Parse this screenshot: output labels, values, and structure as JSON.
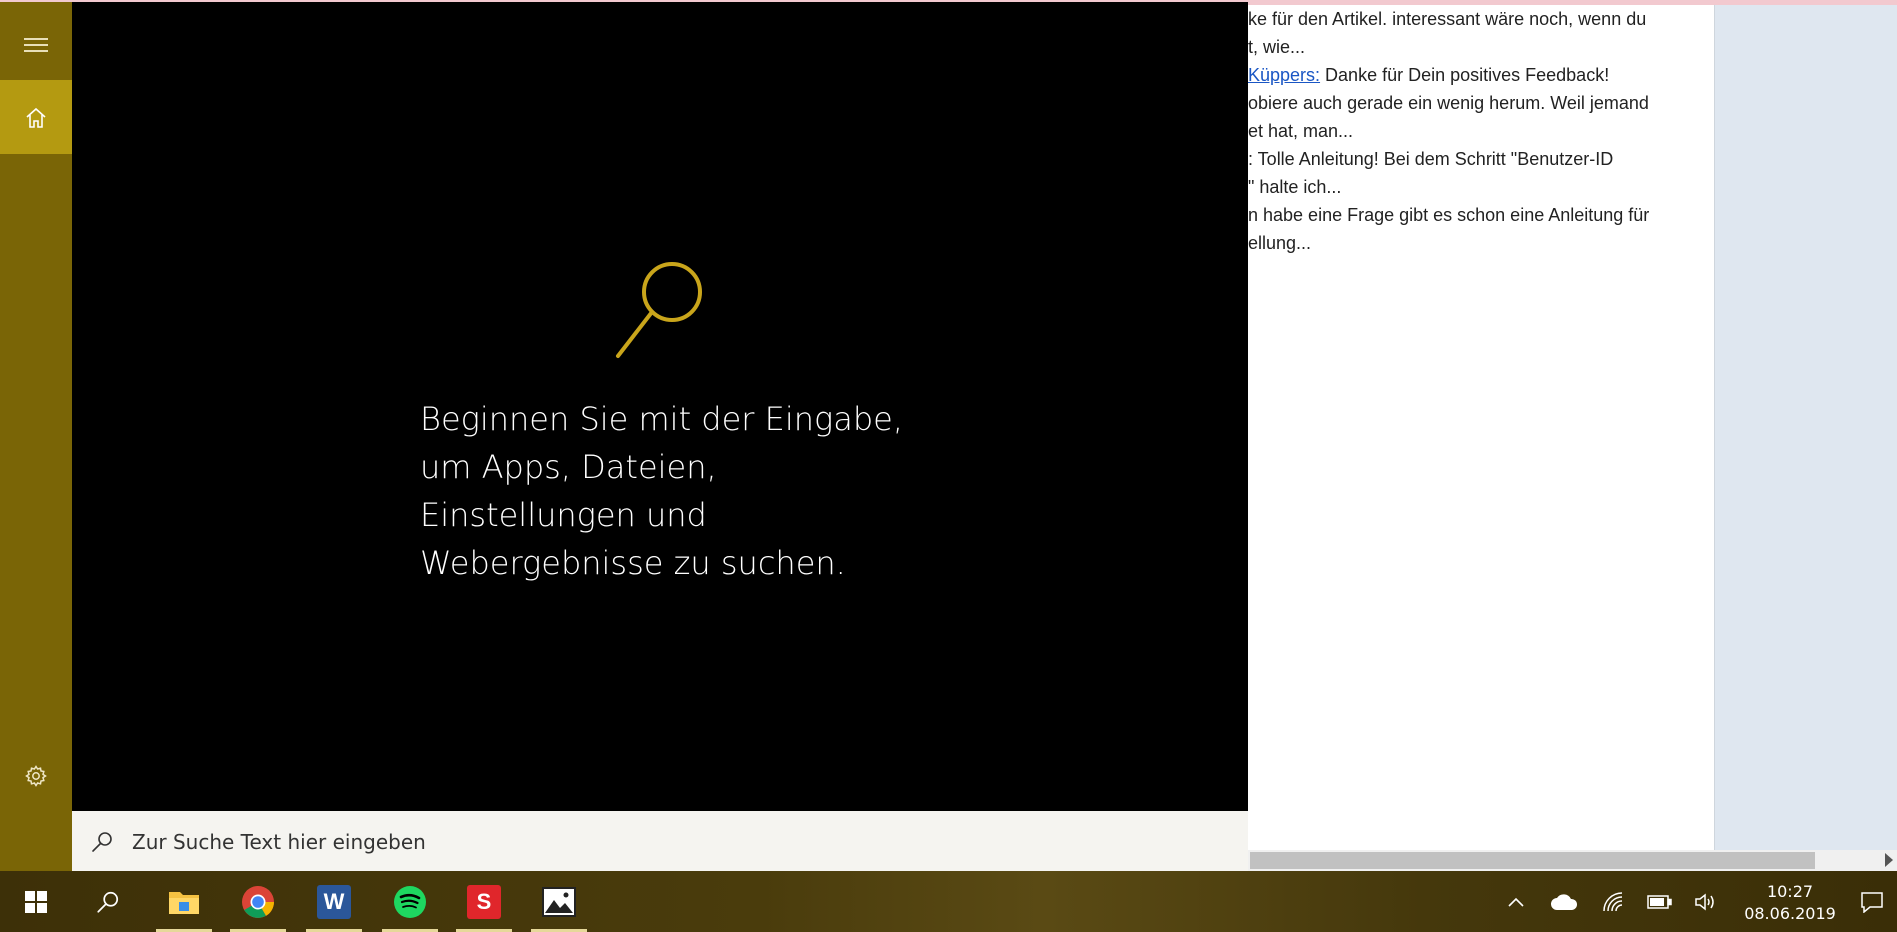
{
  "background_page": {
    "comments": [
      {
        "link": "",
        "text": "ke für den Artikel. interessant wäre noch, wenn du"
      },
      {
        "link": "",
        "text": "t, wie..."
      },
      {
        "link": "Küppers:",
        "text": " Danke für Dein positives Feedback!"
      },
      {
        "link": "",
        "text": "obiere auch gerade ein wenig herum. Weil jemand"
      },
      {
        "link": "",
        "text": "et hat, man..."
      },
      {
        "link": "",
        "text": ": Tolle Anleitung! Bei dem Schritt \"Benutzer-ID"
      },
      {
        "link": "",
        "text": "\" halte ich..."
      },
      {
        "link": "",
        "text": "n habe eine Frage gibt es schon eine Anleitung für"
      },
      {
        "link": "",
        "text": "ellung..."
      }
    ]
  },
  "search": {
    "message_lines": [
      "Beginnen Sie mit der Eingabe,",
      "um Apps, Dateien,",
      "Einstellungen und",
      "Webergebnisse zu suchen."
    ],
    "placeholder": "Zur Suche Text hier eingeben",
    "accent_color": "#c9a51b"
  },
  "taskbar": {
    "apps": [
      {
        "name": "file-explorer",
        "running": true
      },
      {
        "name": "chrome",
        "running": true
      },
      {
        "name": "word",
        "label": "W",
        "running": true
      },
      {
        "name": "spotify",
        "running": true
      },
      {
        "name": "app-s",
        "label": "S",
        "running": true
      },
      {
        "name": "photos",
        "running": true
      }
    ],
    "clock": {
      "time": "10:27",
      "date": "08.06.2019"
    }
  }
}
